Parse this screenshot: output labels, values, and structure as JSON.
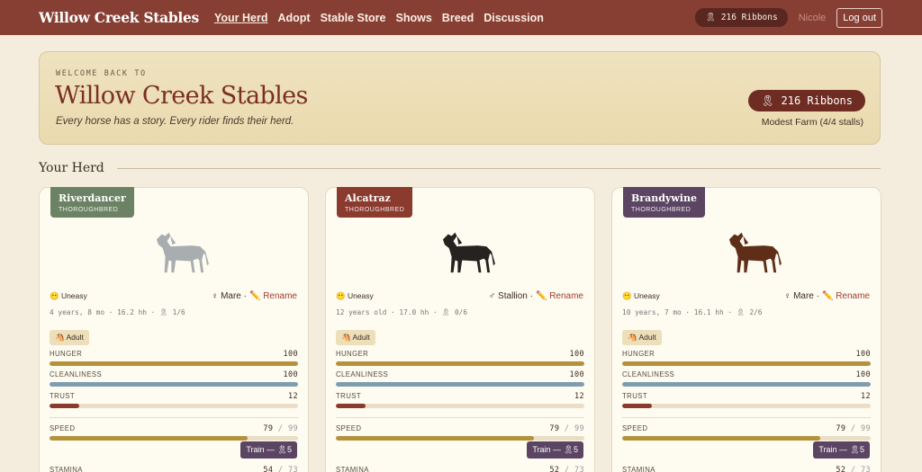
{
  "nav": {
    "brand": "Willow Creek Stables",
    "links": [
      "Your Herd",
      "Adopt",
      "Stable Store",
      "Shows",
      "Breed",
      "Discussion"
    ],
    "ribbons": "🎗 216 Ribbons",
    "user": "Nicole",
    "logout": "Log out"
  },
  "hero": {
    "eyebrow": "WELCOME BACK TO",
    "title": "Willow Creek Stables",
    "subtitle": "Every horse has a story. Every rider finds their herd.",
    "ribbons": "🎗 216 Ribbons",
    "farm": "Modest Farm (4/4 stalls)"
  },
  "section": {
    "title": "Your Herd"
  },
  "cards": [
    {
      "name": "Riverdancer",
      "breed": "THOROUGHBRED",
      "tag_color": "#6c8264",
      "coat": "#a8aeb0",
      "mood": "😶 Uneasy",
      "gender": "♀ Mare ·",
      "rename": "✏️ Rename",
      "meta": "4 years, 8 mo · 16.2 hh · 🎗 1/6",
      "stage": "🐴 Adult",
      "hunger_label": "HUNGER",
      "hunger": "100",
      "clean_label": "CLEANLINESS",
      "clean": "100",
      "trust_label": "TRUST",
      "trust": "12",
      "speed_label": "SPEED",
      "speed": "79",
      "speed_max": "/ 99",
      "train": "Train — 🎗5",
      "stamina_label": "STAMINA",
      "stamina": "54",
      "stamina_max": "/ 73"
    },
    {
      "name": "Alcatraz",
      "breed": "THOROUGHBRED",
      "tag_color": "#8b3a2e",
      "coat": "#262220",
      "mood": "😶 Uneasy",
      "gender": "♂ Stallion ·",
      "rename": "✏️ Rename",
      "meta": "12 years old · 17.0 hh · 🎗 0/6",
      "stage": "🐴 Adult",
      "hunger_label": "HUNGER",
      "hunger": "100",
      "clean_label": "CLEANLINESS",
      "clean": "100",
      "trust_label": "TRUST",
      "trust": "12",
      "speed_label": "SPEED",
      "speed": "79",
      "speed_max": "/ 99",
      "train": "Train — 🎗5",
      "stamina_label": "STAMINA",
      "stamina": "52",
      "stamina_max": "/ 73"
    },
    {
      "name": "Brandywine",
      "breed": "THOROUGHBRED",
      "tag_color": "#5b4563",
      "coat": "#5e2e18",
      "mood": "😶 Uneasy",
      "gender": "♀ Mare ·",
      "rename": "✏️ Rename",
      "meta": "10 years, 7 mo · 16.1 hh · 🎗 2/6",
      "stage": "🐴 Adult",
      "hunger_label": "HUNGER",
      "hunger": "100",
      "clean_label": "CLEANLINESS",
      "clean": "100",
      "trust_label": "TRUST",
      "trust": "12",
      "speed_label": "SPEED",
      "speed": "79",
      "speed_max": "/ 99",
      "train": "Train — 🎗5",
      "stamina_label": "STAMINA",
      "stamina": "52",
      "stamina_max": "/ 73"
    }
  ],
  "colors": {
    "hunger": "#b5913c",
    "clean": "#7e9daf",
    "trust": "#8b3a2e",
    "speed": "#b5913c"
  }
}
